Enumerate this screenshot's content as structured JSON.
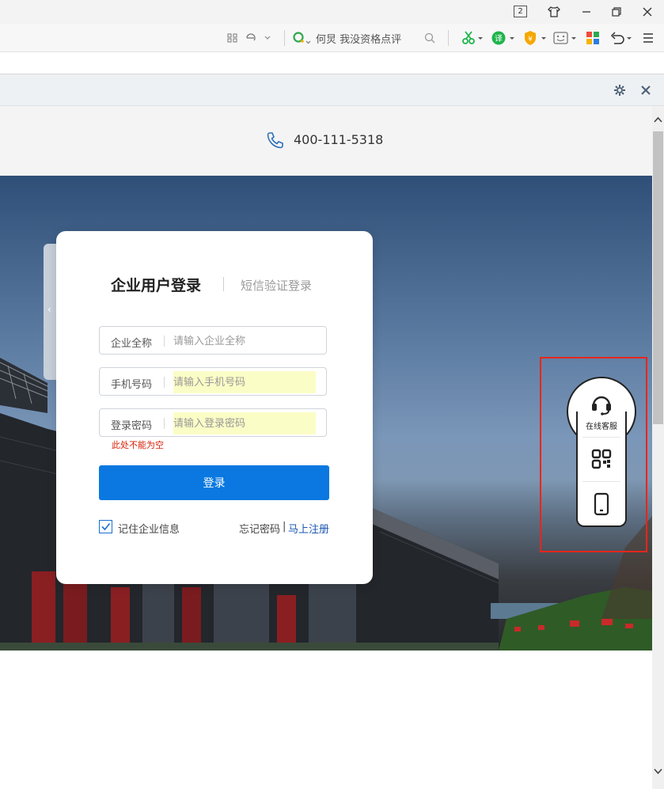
{
  "browser": {
    "window_badge": "2",
    "search_text": "何炅 我没资格点评"
  },
  "header": {
    "phone": "400-111-5318"
  },
  "login": {
    "tab_active": "企业用户登录",
    "tab_inactive": "短信验证登录",
    "fields": [
      {
        "label": "企业全称",
        "placeholder": "请输入企业全称",
        "value": ""
      },
      {
        "label": "手机号码",
        "placeholder": "请输入手机号码",
        "value": ""
      },
      {
        "label": "登录密码",
        "placeholder": "请输入登录密码",
        "value": ""
      }
    ],
    "error": "此处不能为空",
    "submit": "登录",
    "remember": "记住企业信息",
    "remember_checked": true,
    "forgot": "忘记密码",
    "separator": "|",
    "register": "马上注册"
  },
  "float_panel": {
    "service_label": "在线客服"
  },
  "colors": {
    "primary": "#0a78e0",
    "error": "#d81e06",
    "highlight": "#e8261c",
    "link": "#1a55b0"
  }
}
